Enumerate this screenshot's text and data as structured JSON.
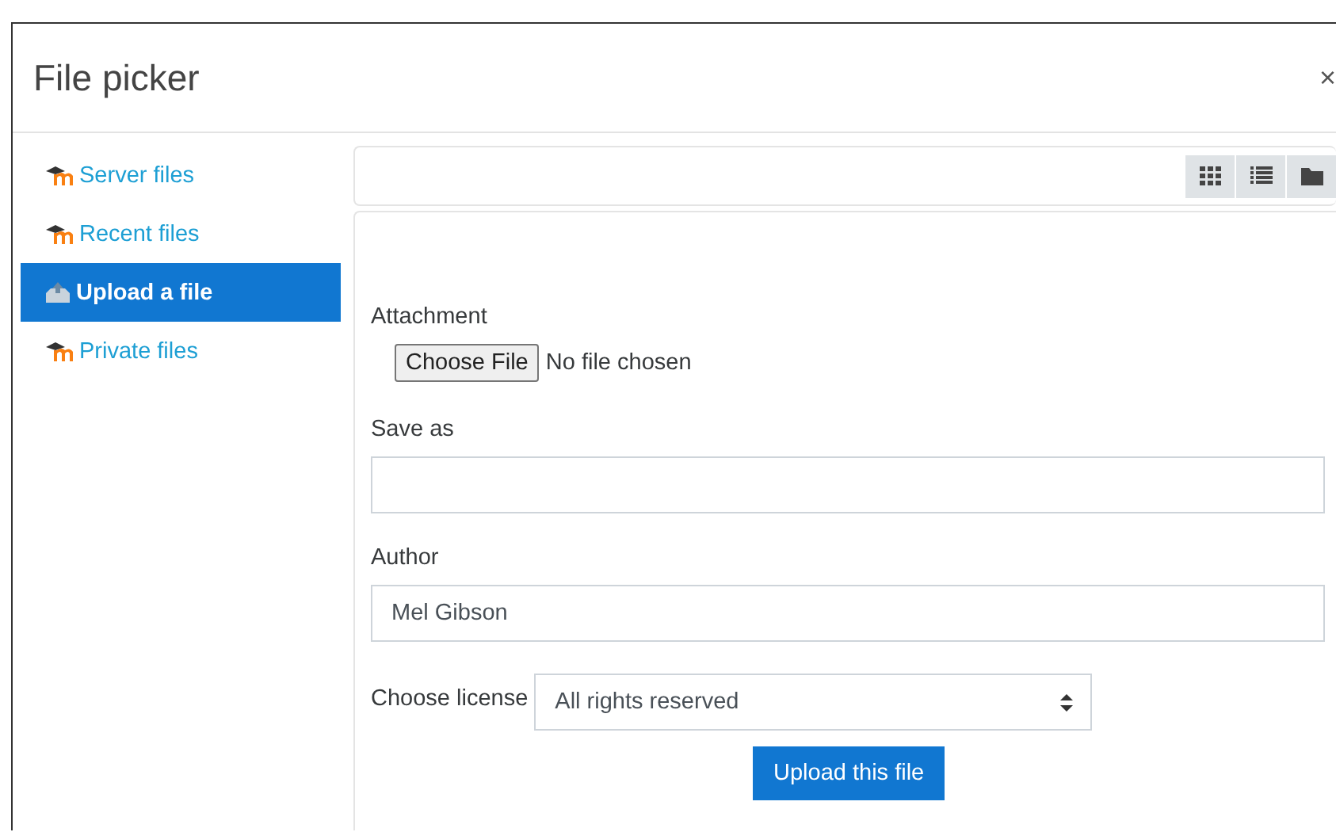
{
  "dialog": {
    "title": "File picker",
    "close": "×"
  },
  "sidebar": {
    "items": [
      {
        "label": "Server files",
        "kind": "repository",
        "selected": false
      },
      {
        "label": "Recent files",
        "kind": "repository",
        "selected": false
      },
      {
        "label": "Upload a file",
        "kind": "upload",
        "selected": true
      },
      {
        "label": "Private files",
        "kind": "repository",
        "selected": false
      }
    ]
  },
  "view_buttons": [
    {
      "kind": "grid"
    },
    {
      "kind": "list"
    },
    {
      "kind": "folder"
    }
  ],
  "form": {
    "attachment": {
      "label": "Attachment",
      "button": "Choose File",
      "status": "No file chosen"
    },
    "save_as": {
      "label": "Save as"
    },
    "author": {
      "label": "Author",
      "value": "Mel Gibson"
    },
    "license": {
      "label": "Choose license",
      "value": "All rights reserved"
    },
    "submit": "Upload this file"
  }
}
